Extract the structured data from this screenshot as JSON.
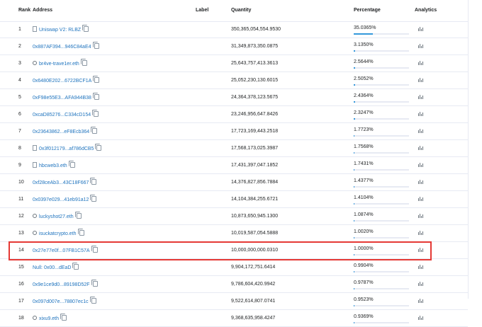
{
  "table": {
    "columns": {
      "rank": "Rank",
      "address": "Address",
      "label": "Label",
      "quantity": "Quantity",
      "percentage": "Percentage",
      "analytics": "Analytics"
    },
    "rows": [
      {
        "rank": "1",
        "address": "Uniswap V2: RLBZ",
        "icon": "contract-icon",
        "quantity": "350,365,054,554.9530",
        "percentage": "35.0365%",
        "pct_value": 35.0365
      },
      {
        "rank": "2",
        "address": "0x887AF394...946C84aE4",
        "icon": "",
        "quantity": "31,349,873,350.0875",
        "percentage": "3.1350%",
        "pct_value": 3.135
      },
      {
        "rank": "3",
        "address": "br4ve-trave1er.eth",
        "icon": "ens-icon",
        "quantity": "25,643,757,413.3613",
        "percentage": "2.5644%",
        "pct_value": 2.5644
      },
      {
        "rank": "4",
        "address": "0x6480E202...6722BCF1A",
        "icon": "",
        "quantity": "25,052,230,130.6015",
        "percentage": "2.5052%",
        "pct_value": 2.5052
      },
      {
        "rank": "5",
        "address": "0xF98e55E3...AFA944B38",
        "icon": "",
        "quantity": "24,364,378,123.5675",
        "percentage": "2.4364%",
        "pct_value": 2.4364
      },
      {
        "rank": "6",
        "address": "0xcaD85276...C334cD154",
        "icon": "",
        "quantity": "23,246,956,647.8426",
        "percentage": "2.3247%",
        "pct_value": 2.3247
      },
      {
        "rank": "7",
        "address": "0x23643862...eF8Ecb364",
        "icon": "",
        "quantity": "17,723,169,443.2518",
        "percentage": "1.7723%",
        "pct_value": 1.7723
      },
      {
        "rank": "8",
        "address": "0x3f012179...af786dCB5",
        "icon": "contract-icon",
        "quantity": "17,568,173,025.3987",
        "percentage": "1.7568%",
        "pct_value": 1.7568
      },
      {
        "rank": "9",
        "address": "hbcweb3.eth",
        "icon": "contract-icon",
        "quantity": "17,431,397,047.1852",
        "percentage": "1.7431%",
        "pct_value": 1.7431
      },
      {
        "rank": "10",
        "address": "0xf28ceAb3...43C18F667",
        "icon": "",
        "quantity": "14,376,827,856.7884",
        "percentage": "1.4377%",
        "pct_value": 1.4377
      },
      {
        "rank": "11",
        "address": "0x0397e029...41eb91a12",
        "icon": "",
        "quantity": "14,104,384,255.6721",
        "percentage": "1.4104%",
        "pct_value": 1.4104
      },
      {
        "rank": "12",
        "address": "luckyshot27.eth",
        "icon": "ens-icon",
        "quantity": "10,873,650,945.1300",
        "percentage": "1.0874%",
        "pct_value": 1.0874
      },
      {
        "rank": "13",
        "address": "isuckatcrypto.eth",
        "icon": "ens-icon",
        "quantity": "10,019,587,054.5888",
        "percentage": "1.0020%",
        "pct_value": 1.002
      },
      {
        "rank": "14",
        "address": "0x27e77e0f...07FB1C57A",
        "icon": "",
        "quantity": "10,000,000,000.0310",
        "percentage": "1.0000%",
        "pct_value": 1.0
      },
      {
        "rank": "15",
        "address": "Null: 0x00...dEaD",
        "icon": "",
        "quantity": "9,904,172,751.6414",
        "percentage": "0.9904%",
        "pct_value": 0.9904
      },
      {
        "rank": "16",
        "address": "0x9e1ce9d0...89198D52F",
        "icon": "",
        "quantity": "9,786,604,420.9942",
        "percentage": "0.9787%",
        "pct_value": 0.9787
      },
      {
        "rank": "17",
        "address": "0x097d007e...78807ec1c",
        "icon": "",
        "quantity": "9,522,614,807.0741",
        "percentage": "0.9523%",
        "pct_value": 0.9523
      },
      {
        "rank": "18",
        "address": "xixu9.eth",
        "icon": "ens-icon",
        "quantity": "9,368,635,958.4247",
        "percentage": "0.9369%",
        "pct_value": 0.9369
      }
    ]
  },
  "highlight_color": "#e53935",
  "link_color": "#1e73be",
  "progress_color": "#3498db"
}
